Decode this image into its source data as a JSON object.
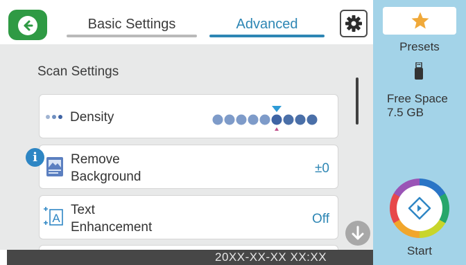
{
  "header": {
    "tabs": [
      {
        "label": "Basic Settings",
        "active": false
      },
      {
        "label": "Advanced",
        "active": true
      }
    ]
  },
  "main": {
    "section_title": "Scan Settings",
    "items": [
      {
        "label": "Density",
        "icon": "density-dots-icon",
        "level": 6,
        "levels": 9
      },
      {
        "label_line1": "Remove",
        "label_line2": "Background",
        "value": "±0",
        "icon": "remove-background-icon"
      },
      {
        "label_line1": "Text",
        "label_line2": "Enhancement",
        "value": "Off",
        "icon": "text-enhancement-icon"
      }
    ]
  },
  "sidebar": {
    "presets_label": "Presets",
    "free_space_label": "Free Space",
    "free_space_value": "7.5 GB",
    "start_label": "Start"
  },
  "status": {
    "datetime": "20XX-XX-XX XX:XX"
  },
  "colors": {
    "accent": "#2d86b4",
    "back_button": "#2f9a44",
    "side_panel": "#a3d3e8",
    "density_dot": "#6b8fbf",
    "density_dot_active": "#4a6fa8",
    "info_badge": "#2e86c4"
  }
}
